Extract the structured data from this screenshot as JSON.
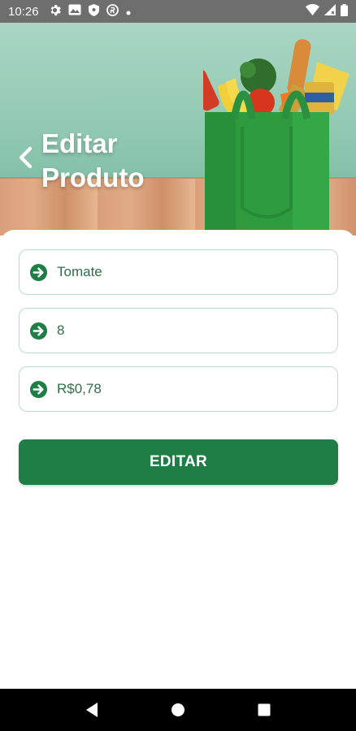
{
  "status_bar": {
    "time": "10:26",
    "left_icons": [
      "gear-icon",
      "image-icon",
      "shield-icon",
      "circle-r-icon",
      "dot-icon"
    ],
    "right_icons": [
      "wifi-icon",
      "signal-icon",
      "battery-icon"
    ]
  },
  "header": {
    "back_icon": "chevron-left-icon",
    "title_line1": "Editar",
    "title_line2": "Produto"
  },
  "form": {
    "fields": [
      {
        "icon": "arrow-right-circle-icon",
        "value": "Tomate"
      },
      {
        "icon": "arrow-right-circle-icon",
        "value": "8"
      },
      {
        "icon": "arrow-right-circle-icon",
        "value": "R$0,78"
      }
    ],
    "submit_label": "EDITAR"
  },
  "colors": {
    "primary": "#1e7e45",
    "field_border": "#bcdccb",
    "field_text": "#2e6f47",
    "status_bar": "#6e6e6e"
  },
  "nav_bar": {
    "buttons": [
      "back-triangle-icon",
      "home-circle-icon",
      "recents-square-icon"
    ]
  }
}
